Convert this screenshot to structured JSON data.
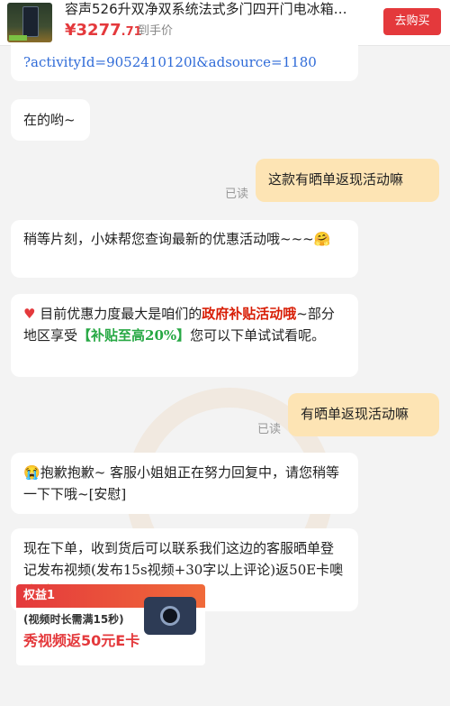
{
  "product": {
    "name": "容声526升双净双系统法式多门四开门电冰箱…",
    "price_main": "¥3277",
    "price_decimal": ".71",
    "price_label": "到手价",
    "buy_button": "去购买"
  },
  "messages": [
    {
      "side": "left",
      "text": "?activityId=9052410120l&adsource=1180"
    },
    {
      "side": "left",
      "text": "在的哟~"
    },
    {
      "side": "right",
      "text": "这款有晒单返现活动嘛",
      "status": "已读"
    },
    {
      "side": "left",
      "text": "稍等片刻，小妹帮您查询最新的优惠活动哦~~~",
      "emoji": "🤗"
    },
    {
      "side": "left",
      "parts": {
        "pre": "目前优惠力度最大是咱们的",
        "hl1": "政府补贴活动哦",
        "mid": "~部分地区享受",
        "hl2": "【补贴至高20%】",
        "post": "您可以下单试试看呢。"
      }
    },
    {
      "side": "right",
      "text": "有晒单返现活动嘛",
      "status": "已读"
    },
    {
      "side": "left",
      "text": "抱歉抱歉~ 客服小姐姐正在努力回复中，请您稍等一下下哦~[安慰]",
      "emoji": "😭"
    },
    {
      "side": "left",
      "text": "现在下单，收到货后可以联系我们这边的客服晒单登记发布视频(发布15s视频+30字以上评论)返50E卡噢",
      "emoji": "✌✌"
    }
  ],
  "card": {
    "tag": "权益1",
    "subtitle": "(视频时长需满15秒)",
    "title": "秀视频返50元E卡"
  },
  "colors": {
    "accent_red": "#e4393c",
    "bubble_right": "#fde4b4",
    "bubble_left": "#ffffff",
    "highlight_green": "#27a844"
  }
}
